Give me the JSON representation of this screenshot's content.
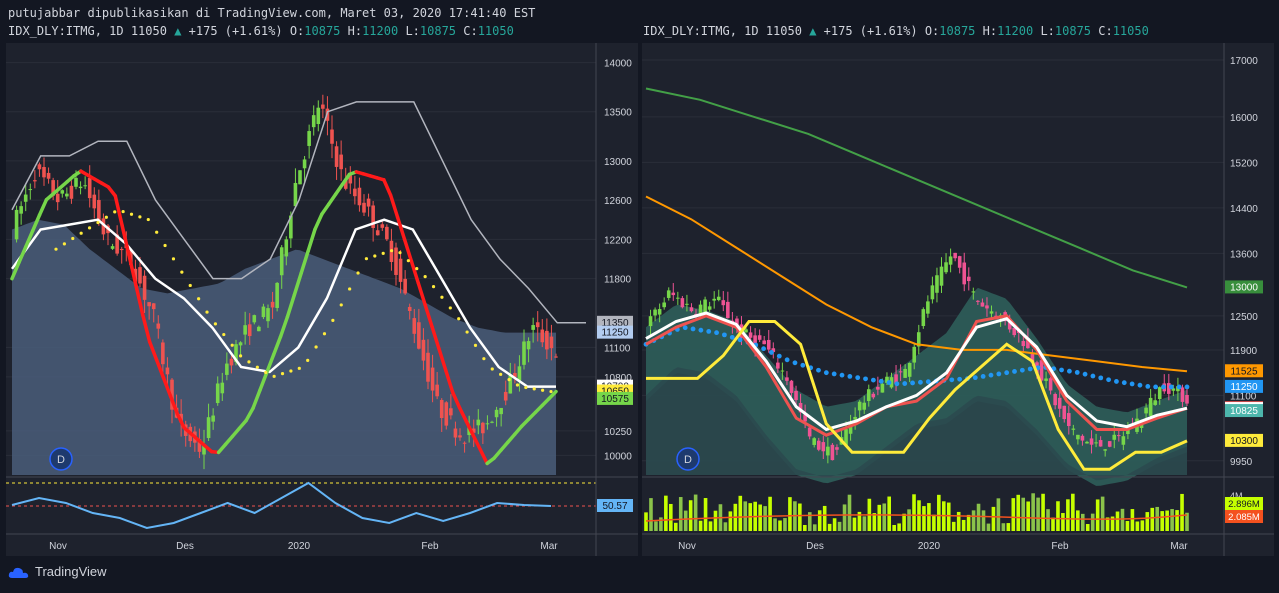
{
  "header": {
    "publish_line": "putujabbar dipublikasikan di TradingView.com, Maret 03, 2020 17:41:40 EST"
  },
  "left": {
    "symbol": "IDX_DLY:ITMG, 1D 11050",
    "change": "+175 (+1.61%)",
    "o_label": "O:",
    "o": "10875",
    "h_label": "H:",
    "h": "11200",
    "l_label": "L:",
    "l": "10875",
    "c_label": "C:",
    "c": "11050",
    "price_ticks": [
      "14000",
      "13500",
      "13000",
      "12600",
      "12200",
      "11800",
      "11100",
      "10800",
      "10250",
      "10000"
    ],
    "badges": [
      {
        "text": "11350",
        "value": 11350,
        "bg": "#b2b5be",
        "fg": "#131722"
      },
      {
        "text": "11250",
        "value": 11250,
        "bg": "#b2ccf0",
        "fg": "#131722"
      },
      {
        "text": "10700",
        "value": 10700,
        "bg": "#ffffff",
        "fg": "#131722"
      },
      {
        "text": "10650",
        "value": 10650,
        "bg": "#ffeb3b",
        "fg": "#131722"
      },
      {
        "text": "10575",
        "value": 10575,
        "bg": "#76d64a",
        "fg": "#131722"
      }
    ],
    "osc_badge": "50.57",
    "time_ticks": [
      "Nov",
      "Des",
      "2020",
      "Feb",
      "Mar"
    ],
    "d_badge": "D"
  },
  "right": {
    "symbol": "IDX_DLY:ITMG, 1D 11050",
    "change": "+175 (+1.61%)",
    "o_label": "O:",
    "o": "10875",
    "h_label": "H:",
    "h": "11200",
    "l_label": "L:",
    "l": "10875",
    "c_label": "C:",
    "c": "11050",
    "price_ticks": [
      "17000",
      "16000",
      "15200",
      "14400",
      "13600",
      "12500",
      "11900",
      "11100",
      "9950"
    ],
    "badges": [
      {
        "text": "13000",
        "value": 13000,
        "bg": "#388e3c",
        "fg": "#ffffff"
      },
      {
        "text": "11525",
        "value": 11525,
        "bg": "#ff9800",
        "fg": "#131722"
      },
      {
        "text": "11250",
        "value": 11250,
        "bg": "#2196f3",
        "fg": "#ffffff"
      },
      {
        "text": "10875",
        "value": 10875,
        "bg": "#ef5350",
        "fg": "#ffffff"
      },
      {
        "text": "10875",
        "value": 10860,
        "bg": "#ffffff",
        "fg": "#131722"
      },
      {
        "text": "10825",
        "value": 10825,
        "bg": "#4db6ac",
        "fg": "#ffffff"
      },
      {
        "text": "10300",
        "value": 10300,
        "bg": "#ffeb3b",
        "fg": "#131722"
      }
    ],
    "vol_badges": [
      {
        "text": "2.896M",
        "bg": "#c6ff00",
        "fg": "#131722"
      },
      {
        "text": "2.085M",
        "bg": "#f4511e",
        "fg": "#ffffff"
      }
    ],
    "vol_tick": "4M",
    "time_ticks": [
      "Nov",
      "Des",
      "2020",
      "Feb",
      "Mar"
    ],
    "d_badge": "D"
  },
  "footer": {
    "brand": "TradingView"
  },
  "colors": {
    "bg": "#131722",
    "up": "#76d64a",
    "down": "#ef5350",
    "grid": "#2a2e39"
  },
  "chart_data": [
    {
      "type": "line",
      "title": "IDX_DLY:ITMG, 1D",
      "ylim": [
        9800,
        14200
      ],
      "x": [
        "Nov",
        "Des",
        "2020",
        "Feb",
        "Mar"
      ],
      "series": [
        {
          "name": "close",
          "values": [
            12300,
            12900,
            12600,
            12800,
            12200,
            12000,
            11400,
            10300,
            10050,
            10900,
            11300,
            11500,
            12800,
            13600,
            12800,
            12500,
            12100,
            11300,
            10500,
            10200,
            10300,
            10700,
            11300,
            11050
          ]
        }
      ],
      "oscillator": {
        "last": 50.57
      }
    },
    {
      "type": "line",
      "title": "IDX_DLY:ITMG, 1D",
      "ylim": [
        9700,
        17300
      ],
      "x": [
        "Nov",
        "Des",
        "2020",
        "Feb",
        "Mar"
      ],
      "series": [
        {
          "name": "close",
          "values": [
            12300,
            12900,
            12600,
            12800,
            12200,
            12000,
            11400,
            10300,
            10050,
            10900,
            11300,
            11500,
            12800,
            13600,
            12800,
            12500,
            12100,
            11300,
            10500,
            10200,
            10300,
            10700,
            11300,
            11050
          ]
        }
      ],
      "volume_last": [
        "2.896M",
        "2.085M"
      ]
    }
  ]
}
